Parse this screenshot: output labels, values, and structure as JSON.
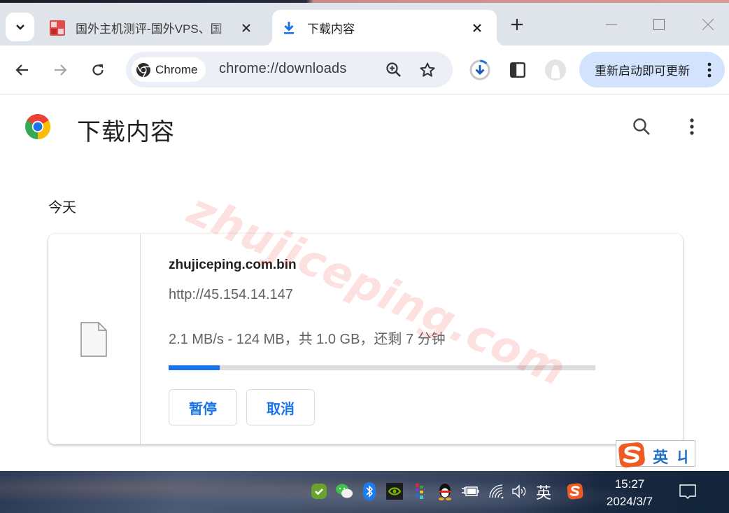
{
  "tabs": [
    {
      "title": "国外主机测评-国外VPS、国",
      "favicon": "site-seal-icon",
      "active": false
    },
    {
      "title": "下载内容",
      "favicon": "download-icon",
      "active": true
    }
  ],
  "toolbar": {
    "chip_label": "Chrome",
    "url": "chrome://downloads",
    "update_label": "重新启动即可更新"
  },
  "page": {
    "title": "下载内容",
    "section_label": "今天"
  },
  "download": {
    "file_name": "zhujiceping.com.bin",
    "source_url": "http://45.154.14.147",
    "status": "2.1 MB/s - 124 MB，共 1.0 GB，还剩 7 分钟",
    "progress_percent": 12,
    "pause_label": "暂停",
    "cancel_label": "取消"
  },
  "watermark": "zhujiceping.com",
  "ime": {
    "mode": "英",
    "extra": "ㄐ"
  },
  "taskbar": {
    "tray_icons": [
      "security-check-icon",
      "wechat-icon",
      "bluetooth-icon",
      "nvidia-icon",
      "color-grid-app-icon",
      "qq-icon",
      "battery-charging-icon",
      "wifi-icon",
      "volume-icon"
    ],
    "ime_label": "英",
    "time": "15:27",
    "date": "2024/3/7"
  },
  "colors": {
    "accent": "#1a73e8",
    "update_chip": "#d3e3fd",
    "tabbar": "#dfe3ea"
  }
}
